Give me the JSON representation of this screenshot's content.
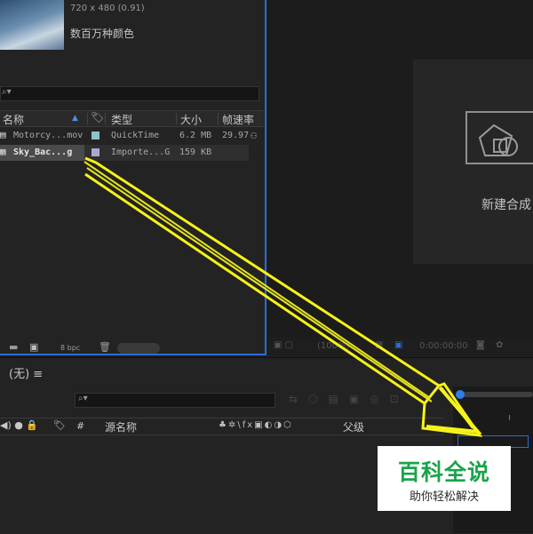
{
  "project": {
    "thumb_dims": "720 x 480 (0.91)",
    "thumb_colors": "数百万种颜色",
    "columns": {
      "name": "名称",
      "type": "类型",
      "size": "大小",
      "framerate": "帧速率"
    },
    "items": [
      {
        "name": "Motorcy...mov",
        "swatch": "#8ec3c9",
        "type": "QuickTime",
        "size": "6.2 MB",
        "fps": "29.97"
      },
      {
        "name": "Sky_Bac...g",
        "swatch": "#a9a7d6",
        "type": "Importe...G",
        "size": "159 KB",
        "fps": ""
      }
    ],
    "bpc": "8 bpc"
  },
  "viewer": {
    "new_comp": "新建合成",
    "zoom": "(100%)",
    "timecode": "0:00:00:00"
  },
  "timeline": {
    "title": "(无) ≡",
    "cols": {
      "hash": "#",
      "source": "源名称",
      "parent": "父级"
    },
    "switches": "♣✲\\fx▣◐◑⬡"
  },
  "watermark": {
    "title": "百科全说",
    "subtitle": "助你轻松解决"
  },
  "colors": {
    "accent": "#2d6bd6",
    "arrow": "#f6f31a",
    "watermark_green": "#1aa34a"
  }
}
